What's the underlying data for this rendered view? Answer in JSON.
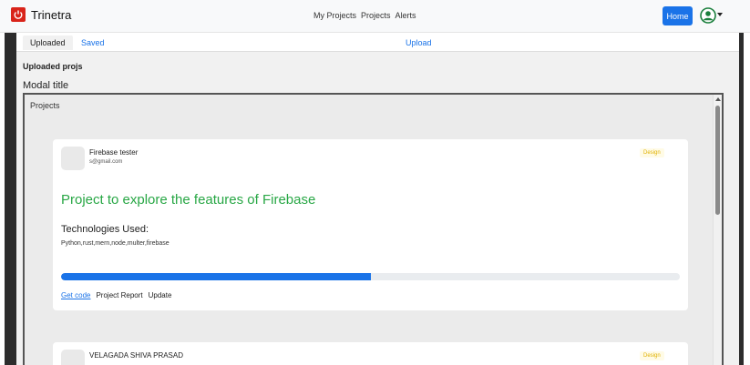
{
  "app": {
    "name": "Trinetra",
    "logo_color": "#d9241a"
  },
  "nav": {
    "links": [
      "My Projects",
      "Projects",
      "Alerts"
    ],
    "home_label": "Home",
    "accent_color": "#1a73e8"
  },
  "tabs": {
    "uploaded": "Uploaded",
    "saved": "Saved",
    "upload": "Upload"
  },
  "section": {
    "heading": "Uploaded projs"
  },
  "modal": {
    "title": "Modal title",
    "body_label": "Projects"
  },
  "projects": [
    {
      "name": "Firebase tester",
      "email": "s@gmail.com",
      "badge": "Design",
      "title": "Project to explore the features of Firebase",
      "tech_heading": "Technologies Used:",
      "technologies": "Python,rust,mern,node,multer,firebase",
      "progress": 0.5,
      "actions": {
        "get_code": "Get code",
        "report": "Project Report",
        "update": "Update"
      }
    },
    {
      "name": "VELAGADA SHIVA PRASAD",
      "badge": "Design"
    }
  ]
}
